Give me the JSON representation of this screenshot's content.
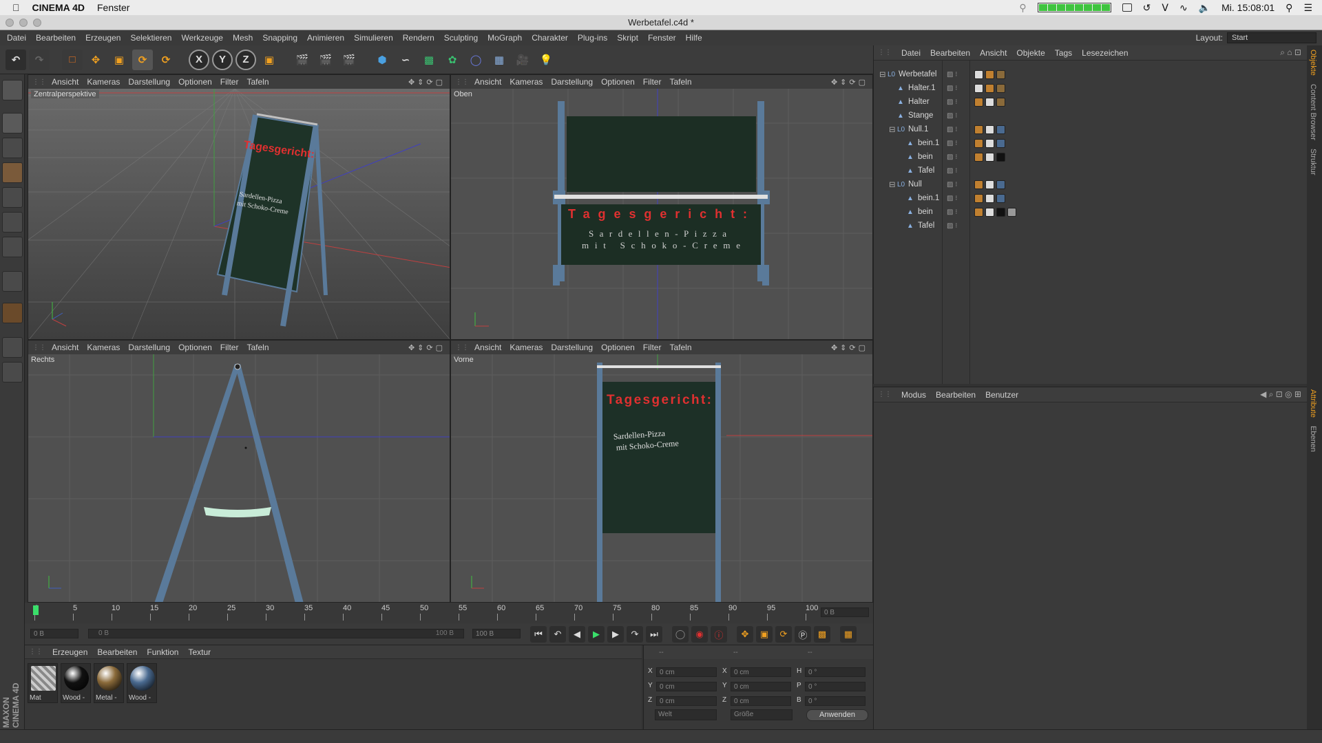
{
  "mac_menubar": {
    "apple": "",
    "app_name": "CINEMA 4D",
    "menu": "Fenster",
    "clock": "Mi. 15:08:01"
  },
  "window_title": "Werbetafel.c4d *",
  "main_menu": [
    "Datei",
    "Bearbeiten",
    "Erzeugen",
    "Selektieren",
    "Werkzeuge",
    "Mesh",
    "Snapping",
    "Animieren",
    "Simulieren",
    "Rendern",
    "Sculpting",
    "MoGraph",
    "Charakter",
    "Plug-ins",
    "Skript",
    "Fenster",
    "Hilfe"
  ],
  "layout": {
    "label": "Layout:",
    "value": "Start"
  },
  "toolbar": {
    "axis_x": "X",
    "axis_y": "Y",
    "axis_z": "Z"
  },
  "viewport_menu": [
    "Ansicht",
    "Kameras",
    "Darstellung",
    "Optionen",
    "Filter",
    "Tafeln"
  ],
  "viewports": {
    "tl": "Zentralperspektive",
    "tr": "Oben",
    "bl": "Rechts",
    "br": "Vorne"
  },
  "sign": {
    "title": "Tagesgericht:",
    "line1": "Sardellen-Pizza",
    "line2": "mit Schoko-Creme"
  },
  "object_manager": {
    "menu": [
      "Datei",
      "Bearbeiten",
      "Ansicht",
      "Objekte",
      "Tags",
      "Lesezeichen"
    ],
    "objects": [
      {
        "name": "Werbetafel",
        "indent": 0,
        "type": "null"
      },
      {
        "name": "Halter.1",
        "indent": 1,
        "type": "obj"
      },
      {
        "name": "Halter",
        "indent": 1,
        "type": "obj"
      },
      {
        "name": "Stange",
        "indent": 1,
        "type": "obj"
      },
      {
        "name": "Null.1",
        "indent": 1,
        "type": "null"
      },
      {
        "name": "bein.1",
        "indent": 2,
        "type": "obj"
      },
      {
        "name": "bein",
        "indent": 2,
        "type": "obj"
      },
      {
        "name": "Tafel",
        "indent": 2,
        "type": "obj"
      },
      {
        "name": "Null",
        "indent": 1,
        "type": "null"
      },
      {
        "name": "bein.1",
        "indent": 2,
        "type": "obj"
      },
      {
        "name": "bein",
        "indent": 2,
        "type": "obj"
      },
      {
        "name": "Tafel",
        "indent": 2,
        "type": "obj"
      }
    ]
  },
  "side_tabs_top": [
    "Objekte",
    "Content Browser",
    "Struktur"
  ],
  "side_tabs_bottom": [
    "Attribute",
    "Ebenen"
  ],
  "attribute_manager": {
    "menu": [
      "Modus",
      "Bearbeiten",
      "Benutzer"
    ]
  },
  "timeline": {
    "ticks": [
      "0",
      "5",
      "10",
      "15",
      "20",
      "25",
      "30",
      "35",
      "40",
      "45",
      "50",
      "55",
      "60",
      "65",
      "70",
      "75",
      "80",
      "85",
      "90",
      "95",
      "100"
    ],
    "current_frame": "0 B"
  },
  "transport": {
    "start_field": "0 B",
    "slider_left": "0 B",
    "slider_right": "100 B",
    "end_field": "100 B"
  },
  "material_manager": {
    "menu": [
      "Erzeugen",
      "Bearbeiten",
      "Funktion",
      "Textur"
    ],
    "materials": [
      {
        "name": "Mat",
        "color": "#8a8a8a"
      },
      {
        "name": "Wood -",
        "color": "#111111"
      },
      {
        "name": "Metal -",
        "color": "#8a6a3a"
      },
      {
        "name": "Wood -",
        "color": "#4a6a90"
      }
    ]
  },
  "coordinates": {
    "headers": [
      "--",
      "--",
      "--"
    ],
    "rows": [
      {
        "a": "X",
        "a_val": "0 cm",
        "b": "X",
        "b_val": "0 cm",
        "c": "H",
        "c_val": "0 °"
      },
      {
        "a": "Y",
        "a_val": "0 cm",
        "b": "Y",
        "b_val": "0 cm",
        "c": "P",
        "c_val": "0 °"
      },
      {
        "a": "Z",
        "a_val": "0 cm",
        "b": "Z",
        "b_val": "0 cm",
        "c": "B",
        "c_val": "0 °"
      }
    ],
    "mode_select": "Welt",
    "size_select": "Größe",
    "apply_button": "Anwenden"
  },
  "maxon_logo": "MAXON CINEMA 4D"
}
